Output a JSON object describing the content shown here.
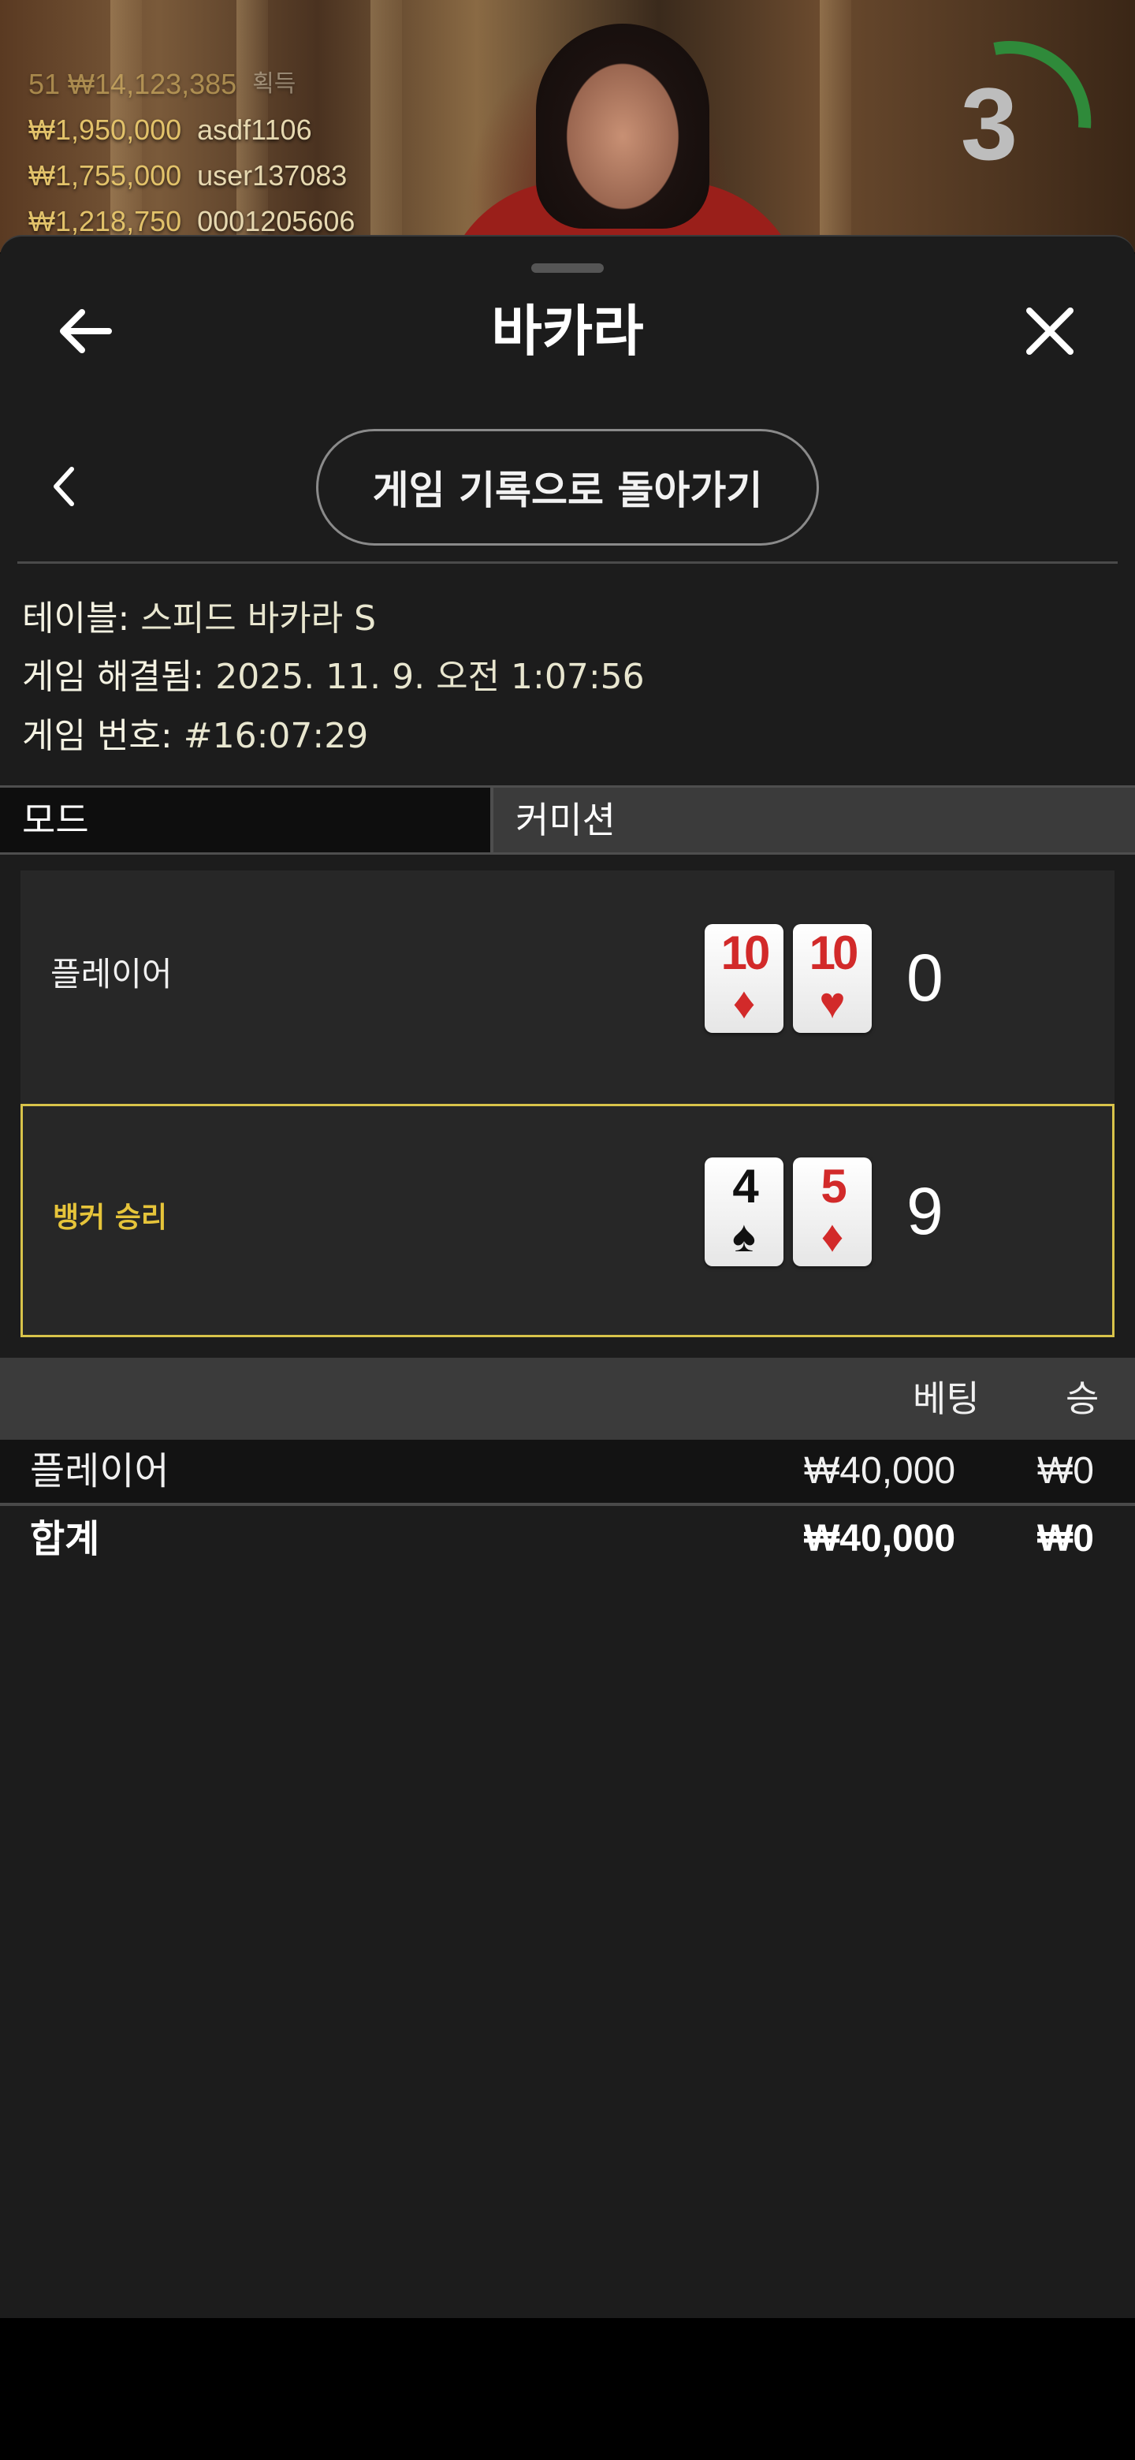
{
  "video": {
    "winners_header": {
      "count_amount": "51 ₩14,123,385",
      "suffix": "획득"
    },
    "winners": [
      {
        "amount": "₩1,950,000",
        "name": "asdf1106"
      },
      {
        "amount": "₩1,755,000",
        "name": "user137083"
      },
      {
        "amount": "₩1,218,750",
        "name": "0001205606"
      }
    ],
    "timer_value": "3",
    "timer_color": "#2f8a3a"
  },
  "sheet": {
    "title": "바카라",
    "back_icon": "arrow-left-icon",
    "close_icon": "close-icon",
    "back_to_history_label": "게임 기록으로 돌아가기",
    "info": {
      "table_label": "테이블:",
      "table_value": "스피드 바카라 S",
      "resolved_label": "게임 해결됨:",
      "resolved_value": "2025. 11. 9. 오전 1:07:56",
      "game_number_label": "게임 번호:",
      "game_number_value": "#16:07:29"
    },
    "mode": {
      "label": "모드",
      "value": "커미션"
    },
    "hands": [
      {
        "label": "플레이어",
        "win": false,
        "cards": [
          {
            "rank": "10",
            "suit": "♦",
            "color": "red"
          },
          {
            "rank": "10",
            "suit": "♥",
            "color": "red"
          }
        ],
        "score": "0"
      },
      {
        "label": "뱅커 승리",
        "win": true,
        "cards": [
          {
            "rank": "4",
            "suit": "♠",
            "color": "black"
          },
          {
            "rank": "5",
            "suit": "♦",
            "color": "red"
          }
        ],
        "score": "9"
      }
    ],
    "bets": {
      "headers": {
        "bet": "베팅",
        "win": "승"
      },
      "rows": [
        {
          "label": "플레이어",
          "bet": "₩40,000",
          "win": "₩0"
        }
      ],
      "total": {
        "label": "합계",
        "bet": "₩40,000",
        "win": "₩0"
      }
    },
    "accent_color": "#d8c34a"
  }
}
